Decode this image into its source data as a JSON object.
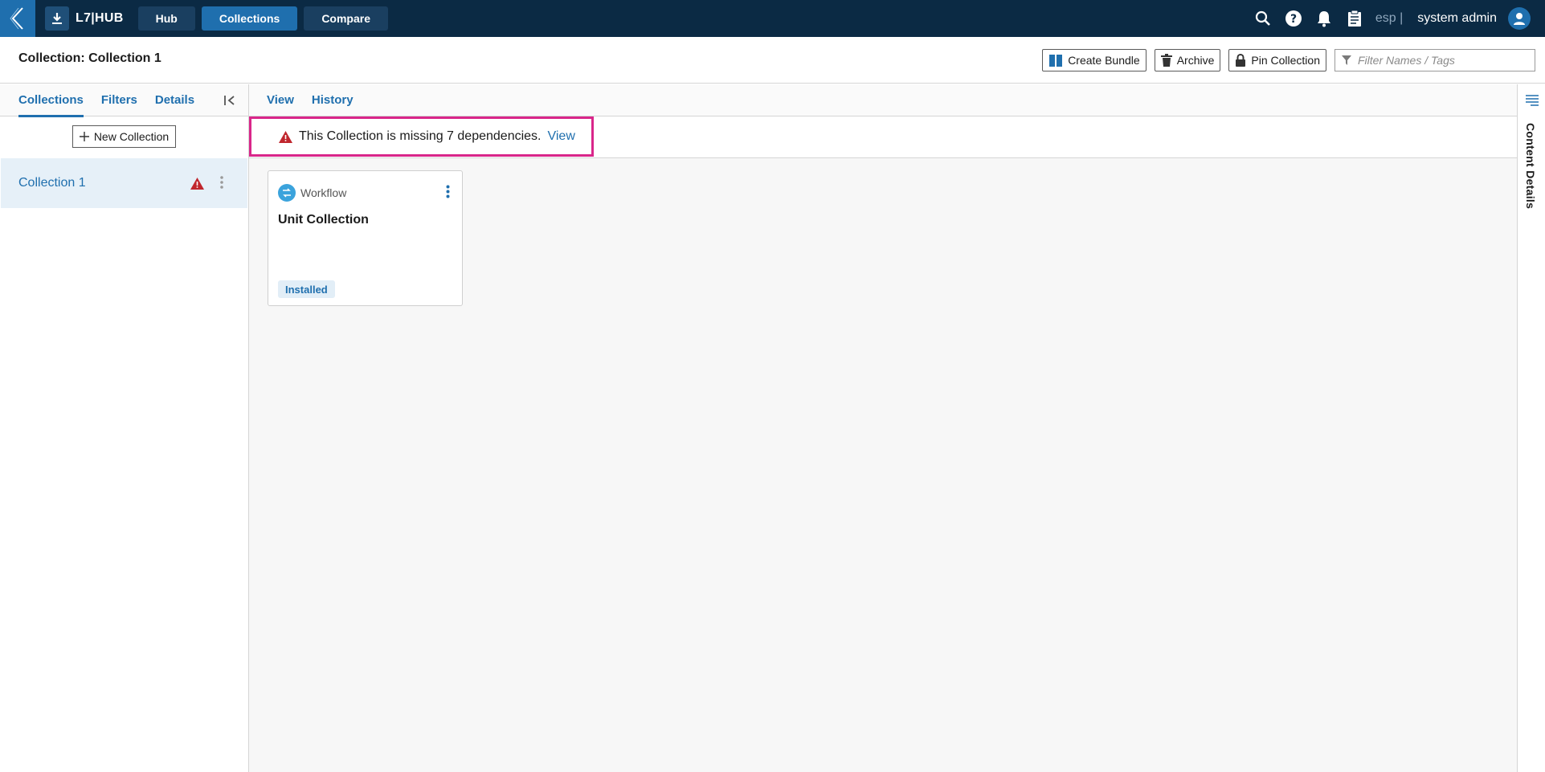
{
  "topbar": {
    "brand": "L7|HUB",
    "nav": [
      {
        "label": "Hub",
        "active": false
      },
      {
        "label": "Collections",
        "active": true
      },
      {
        "label": "Compare",
        "active": false
      }
    ],
    "lang": "esp |",
    "user": "system admin",
    "icons": [
      "search-icon",
      "help-icon",
      "bell-icon",
      "clipboard-icon",
      "user-avatar-icon"
    ]
  },
  "titlebar": {
    "title": "Collection: Collection 1",
    "actions": {
      "create_bundle": "Create Bundle",
      "archive": "Archive",
      "pin": "Pin Collection"
    },
    "filter_placeholder": "Filter Names / Tags"
  },
  "left": {
    "tabs": [
      "Collections",
      "Filters",
      "Details"
    ],
    "active_tab": "Collections",
    "new_collection": "New Collection",
    "items": [
      {
        "label": "Collection 1",
        "warning": true
      }
    ]
  },
  "main": {
    "tabs": [
      "View",
      "History"
    ],
    "alert": {
      "text": "This Collection is missing 7 dependencies.",
      "link": "View"
    },
    "cards": [
      {
        "type": "Workflow",
        "title": "Unit Collection",
        "status": "Installed"
      }
    ]
  },
  "rightrail": {
    "label": "Content Details"
  },
  "colors": {
    "topbar": "#0b2a44",
    "accent": "#1f6fae",
    "warning": "#c0262d",
    "highlight": "#d9268a"
  }
}
